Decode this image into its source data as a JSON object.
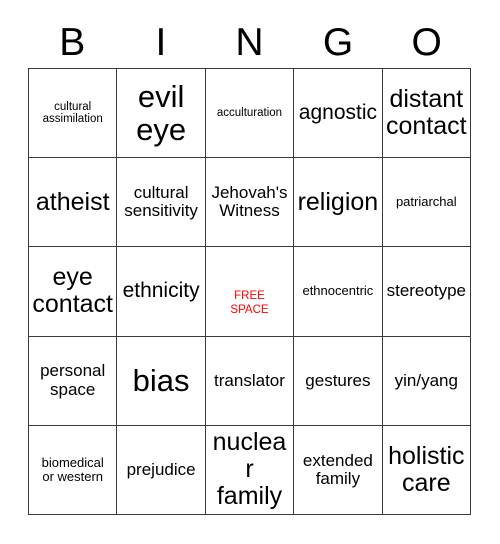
{
  "card": {
    "title": "BINGO",
    "header_letters": [
      "B",
      "I",
      "N",
      "G",
      "O"
    ],
    "free_space_color": "#ff0000",
    "grid_line_color": "#3a3a3a",
    "background_color": "#ffffff",
    "columns": 5,
    "rows": 5,
    "cells": [
      {
        "text": "cultural\nassimilation",
        "size": "xs",
        "free": false
      },
      {
        "text": "evil\neye",
        "size": "xxl",
        "free": false
      },
      {
        "text": "acculturation",
        "size": "xs",
        "free": false
      },
      {
        "text": "agnostic",
        "size": "lg",
        "free": false
      },
      {
        "text": "distant\ncontact",
        "size": "xl",
        "free": false
      },
      {
        "text": "atheist",
        "size": "xl",
        "free": false
      },
      {
        "text": "cultural\nsensitivity",
        "size": "md",
        "free": false
      },
      {
        "text": "Jehovah's\nWitness",
        "size": "md",
        "free": false
      },
      {
        "text": "religion",
        "size": "xl",
        "free": false
      },
      {
        "text": "patriarchal",
        "size": "sm",
        "free": false
      },
      {
        "text": "eye\ncontact",
        "size": "xl",
        "free": false
      },
      {
        "text": "ethnicity",
        "size": "lg",
        "free": false
      },
      {
        "text": "FREE\nSPACE",
        "size": "xs",
        "free": true
      },
      {
        "text": "ethnocentric",
        "size": "sm",
        "free": false
      },
      {
        "text": "stereotype",
        "size": "md",
        "free": false
      },
      {
        "text": "personal\nspace",
        "size": "md",
        "free": false
      },
      {
        "text": "bias",
        "size": "xxl",
        "free": false
      },
      {
        "text": "translator",
        "size": "md",
        "free": false
      },
      {
        "text": "gestures",
        "size": "md",
        "free": false
      },
      {
        "text": "yin/yang",
        "size": "md",
        "free": false
      },
      {
        "text": "biomedical\nor western",
        "size": "sm",
        "free": false
      },
      {
        "text": "prejudice",
        "size": "md",
        "free": false
      },
      {
        "text": "nuclear\nfamily",
        "size": "xl",
        "free": false
      },
      {
        "text": "extended\nfamily",
        "size": "md",
        "free": false
      },
      {
        "text": "holistic\ncare",
        "size": "xl",
        "free": false
      }
    ]
  }
}
